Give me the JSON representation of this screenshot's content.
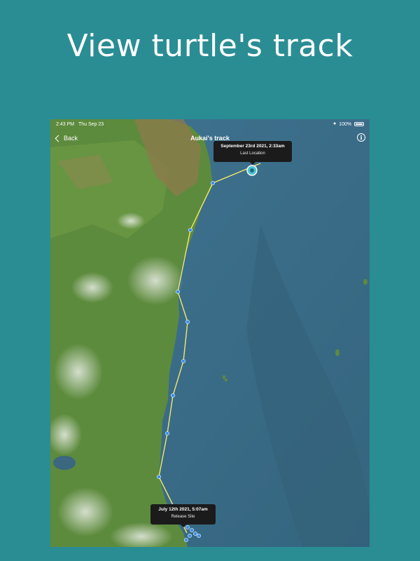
{
  "headline": "View turtle's track",
  "status_bar": {
    "time": "2:43 PM",
    "date": "Thu Sep 23",
    "battery": "100%"
  },
  "nav": {
    "back_label": "Back",
    "title": "Aukai's track",
    "info_icon": "info-icon"
  },
  "callouts": {
    "last_location": {
      "date": "September 23rd 2021, 2:33am",
      "label": "Last Location"
    },
    "release_site": {
      "date": "July 12th 2021, 5:07am",
      "label": "Release Site"
    }
  },
  "colors": {
    "background": "#2a8d94",
    "track_line": "#f2e86a",
    "track_point": "#3a8fe8",
    "ocean": "#3d6e88",
    "land": "#5a8a3a"
  }
}
